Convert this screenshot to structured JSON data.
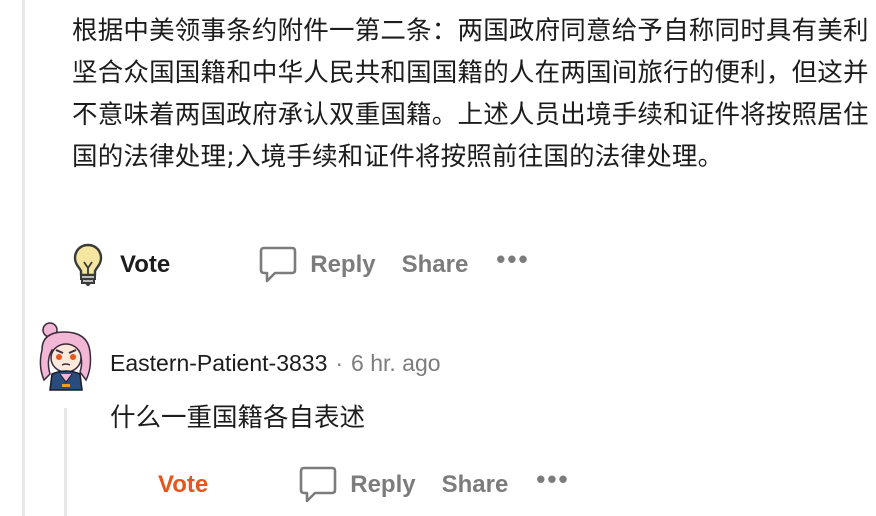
{
  "parent_comment": {
    "body": "根据中美领事条约附件一第二条：两国政府同意给予自称同时具有美利坚合众国国籍和中华人民共和国国籍的人在两国间旅行的便利，但这并不意味着两国政府承认双重国籍。上述人员出境手续和证件将按照居住国的法律处理;入境手续和证件将按照前往国的法律处理。",
    "actions": {
      "vote_label": "Vote",
      "reply_label": "Reply",
      "share_label": "Share",
      "more_label": "•••",
      "vote_icon": "lightbulb-icon",
      "reply_icon": "speech-bubble-icon"
    }
  },
  "child_comment": {
    "username": "Eastern-Patient-3833",
    "separator": "·",
    "timestamp": "6 hr. ago",
    "body": "什么一重国籍各自表述",
    "avatar_icon": "avatar-icon",
    "actions": {
      "vote_label": "Vote",
      "reply_label": "Reply",
      "share_label": "Share",
      "more_label": "•••",
      "reply_icon": "speech-bubble-icon"
    }
  },
  "colors": {
    "text": "#1c1c1c",
    "muted": "#7c7c7c",
    "vote_active": "#e8541d",
    "thread_line": "#e8e8e8"
  }
}
